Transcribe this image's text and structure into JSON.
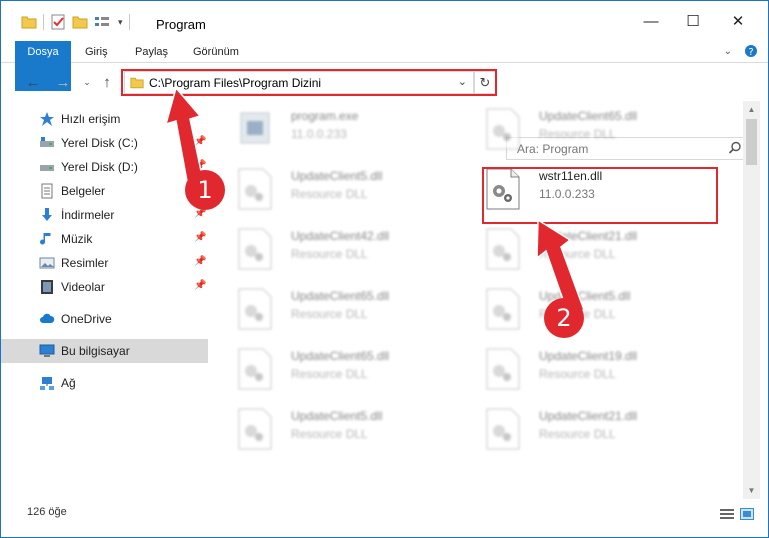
{
  "window": {
    "title": "Program",
    "minimize_glyph": "—",
    "maximize_glyph": "☐",
    "close_glyph": "✕"
  },
  "ribbon": {
    "tabs": [
      "Dosya",
      "Giriş",
      "Paylaş",
      "Görünüm"
    ]
  },
  "address": {
    "path": "C:\\Program Files\\Program Dizini",
    "search_placeholder": "Ara: Program"
  },
  "nav": {
    "items": [
      {
        "label": "Hızlı erişim",
        "icon": "star-icon",
        "pinned": false
      },
      {
        "label": "Yerel Disk (C:)",
        "icon": "drive-icon",
        "pinned": true
      },
      {
        "label": "Yerel Disk (D:)",
        "icon": "drive-icon",
        "pinned": true
      },
      {
        "label": "Belgeler",
        "icon": "documents-icon",
        "pinned": true
      },
      {
        "label": "İndirmeler",
        "icon": "download-icon",
        "pinned": true
      },
      {
        "label": "Müzik",
        "icon": "music-icon",
        "pinned": true
      },
      {
        "label": "Resimler",
        "icon": "pictures-icon",
        "pinned": true
      },
      {
        "label": "Videolar",
        "icon": "videos-icon",
        "pinned": true
      },
      {
        "label": "OneDrive",
        "icon": "cloud-icon",
        "pinned": false
      },
      {
        "label": "Bu bilgisayar",
        "icon": "computer-icon",
        "pinned": false
      },
      {
        "label": "Ağ",
        "icon": "network-icon",
        "pinned": false
      }
    ]
  },
  "files": [
    {
      "name": "program.exe",
      "desc": "11.0.0.233"
    },
    {
      "name": "UpdateClient65.dll",
      "desc": "Resource DLL"
    },
    {
      "name": "UpdateClient5.dll",
      "desc": "Resource DLL"
    },
    {
      "name": "wstr11en.dll",
      "desc": "11.0.0.233"
    },
    {
      "name": "UpdateClient42.dll",
      "desc": "Resource DLL"
    },
    {
      "name": "UpdateClient21.dll",
      "desc": "Resource DLL"
    },
    {
      "name": "UpdateClient65.dll",
      "desc": "Resource DLL"
    },
    {
      "name": "UpdateClient5.dll",
      "desc": "Resource DLL"
    },
    {
      "name": "UpdateClient65.dll",
      "desc": "Resource DLL"
    },
    {
      "name": "UpdateClient19.dll",
      "desc": "Resource DLL"
    },
    {
      "name": "UpdateClient5.dll",
      "desc": "Resource DLL"
    },
    {
      "name": "UpdateClient21.dll",
      "desc": "Resource DLL"
    }
  ],
  "status": {
    "count": "126 öğe"
  },
  "annotations": {
    "step1": "1",
    "step2": "2",
    "color": "#e0282e"
  }
}
